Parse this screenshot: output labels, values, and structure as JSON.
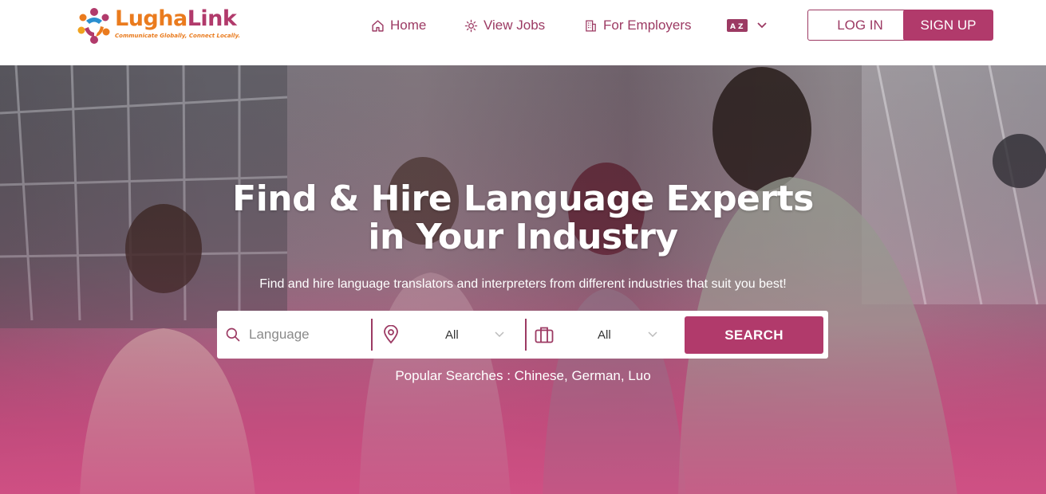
{
  "brand": {
    "name_part1": "Lugha",
    "name_part2": "Link",
    "tagline": "Communicate Globally, Connect Locally.",
    "colors": {
      "primary": "#b13a6b",
      "orange": "#ea7b1e",
      "blue": "#2a8fd0"
    }
  },
  "nav": {
    "items": [
      {
        "label": "Home",
        "icon": "home-icon"
      },
      {
        "label": "View Jobs",
        "icon": "lightbulb-icon"
      },
      {
        "label": "For Employers",
        "icon": "building-icon"
      }
    ],
    "language_switch_icon": "translate-icon",
    "login_label": "LOG IN",
    "signup_label": "SIGN UP"
  },
  "hero": {
    "title_line1": "Find & Hire Language Experts",
    "title_line2": "in Your Industry",
    "subtitle": "Find and hire language translators and interpreters from different industries that suit you best!",
    "search": {
      "language_placeholder": "Language",
      "location_value": "All",
      "industry_value": "All",
      "button_label": "SEARCH"
    },
    "popular_searches": "Popular Searches : Chinese, German, Luo"
  }
}
